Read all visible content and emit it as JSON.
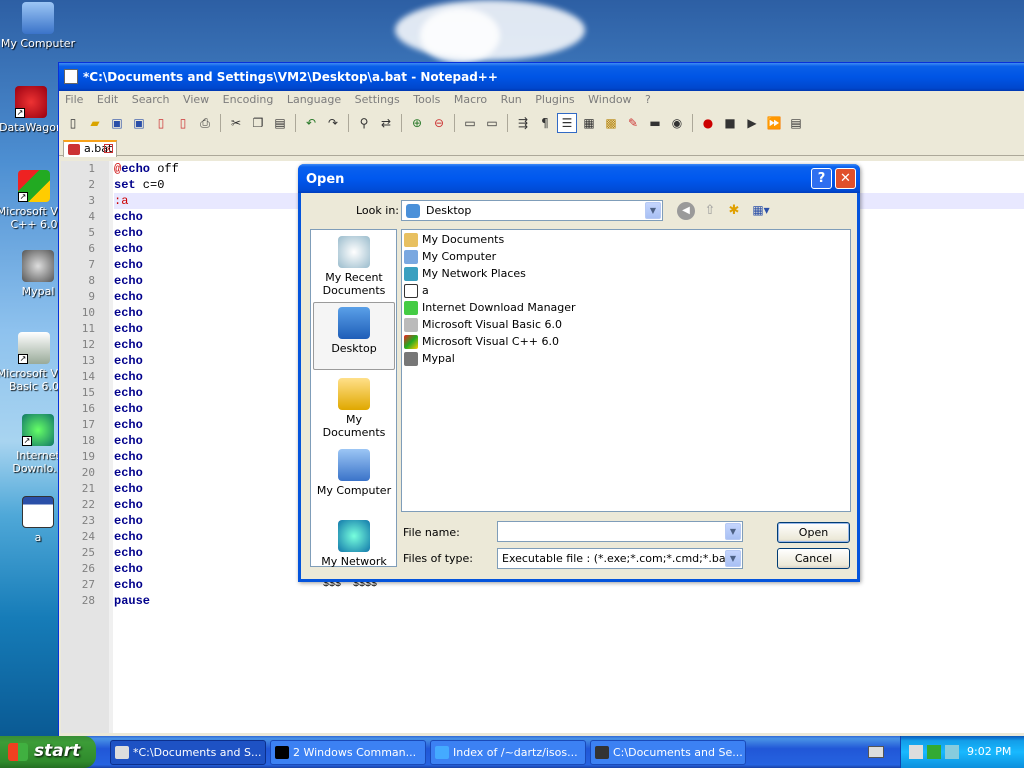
{
  "desktop": {
    "icons": [
      {
        "label": "My Computer"
      },
      {
        "label": "DataWagon"
      },
      {
        "label": "Microsoft Vi... C++ 6.0"
      },
      {
        "label": "Mypal"
      },
      {
        "label": "Microsoft Vi... Basic 6.0"
      },
      {
        "label": "Internet Downlo..."
      },
      {
        "label": "a"
      }
    ]
  },
  "notepad": {
    "title": "*C:\\Documents and Settings\\VM2\\Desktop\\a.bat - Notepad++",
    "menu": [
      "File",
      "Edit",
      "Search",
      "View",
      "Encoding",
      "Language",
      "Settings",
      "Tools",
      "Macro",
      "Run",
      "Plugins",
      "Window",
      "?"
    ],
    "tab": "a.bat",
    "lines": [
      {
        "n": "1",
        "parts": [
          {
            "t": "@",
            "c": "at"
          },
          {
            "t": "echo",
            "c": "kw"
          },
          {
            "t": " off",
            "c": ""
          }
        ]
      },
      {
        "n": "2",
        "parts": [
          {
            "t": "set",
            "c": "kw"
          },
          {
            "t": " c=0",
            "c": ""
          }
        ]
      },
      {
        "n": "3",
        "parts": [
          {
            "t": ":a",
            "c": "at"
          }
        ]
      },
      {
        "n": "4",
        "parts": [
          {
            "t": "echo",
            "c": "kw"
          }
        ]
      },
      {
        "n": "5",
        "parts": [
          {
            "t": "echo",
            "c": "kw"
          }
        ]
      },
      {
        "n": "6",
        "parts": [
          {
            "t": "echo",
            "c": "kw"
          }
        ]
      },
      {
        "n": "7",
        "parts": [
          {
            "t": "echo",
            "c": "kw"
          }
        ]
      },
      {
        "n": "8",
        "parts": [
          {
            "t": "echo",
            "c": "kw"
          }
        ]
      },
      {
        "n": "9",
        "parts": [
          {
            "t": "echo",
            "c": "kw"
          }
        ]
      },
      {
        "n": "10",
        "parts": [
          {
            "t": "echo",
            "c": "kw"
          }
        ]
      },
      {
        "n": "11",
        "parts": [
          {
            "t": "echo",
            "c": "kw"
          }
        ]
      },
      {
        "n": "12",
        "parts": [
          {
            "t": "echo",
            "c": "kw"
          }
        ]
      },
      {
        "n": "13",
        "parts": [
          {
            "t": "echo",
            "c": "kw"
          }
        ]
      },
      {
        "n": "14",
        "parts": [
          {
            "t": "echo",
            "c": "kw"
          }
        ]
      },
      {
        "n": "15",
        "parts": [
          {
            "t": "echo",
            "c": "kw"
          }
        ]
      },
      {
        "n": "16",
        "parts": [
          {
            "t": "echo",
            "c": "kw"
          }
        ]
      },
      {
        "n": "17",
        "parts": [
          {
            "t": "echo",
            "c": "kw"
          }
        ]
      },
      {
        "n": "18",
        "parts": [
          {
            "t": "echo",
            "c": "kw"
          }
        ]
      },
      {
        "n": "19",
        "parts": [
          {
            "t": "echo",
            "c": "kw"
          }
        ]
      },
      {
        "n": "20",
        "parts": [
          {
            "t": "echo",
            "c": "kw"
          }
        ]
      },
      {
        "n": "21",
        "parts": [
          {
            "t": "echo",
            "c": "kw"
          }
        ]
      },
      {
        "n": "22",
        "parts": [
          {
            "t": "echo",
            "c": "kw"
          }
        ]
      },
      {
        "n": "23",
        "parts": [
          {
            "t": "echo",
            "c": "kw"
          }
        ]
      },
      {
        "n": "24",
        "parts": [
          {
            "t": "echo",
            "c": "kw"
          }
        ]
      },
      {
        "n": "25",
        "parts": [
          {
            "t": "echo",
            "c": "kw"
          }
        ]
      },
      {
        "n": "26",
        "parts": [
          {
            "t": "echo",
            "c": "kw"
          }
        ]
      },
      {
        "n": "27",
        "parts": [
          {
            "t": "echo",
            "c": "kw"
          }
        ]
      },
      {
        "n": "28",
        "parts": [
          {
            "t": "pause",
            "c": "kw"
          }
        ]
      }
    ],
    "line27_tail": "$$$* $$$$*"
  },
  "dialog": {
    "title": "Open",
    "look_in_label": "Look in:",
    "look_in_value": "Desktop",
    "places": [
      "My Recent Documents",
      "Desktop",
      "My Documents",
      "My Computer",
      "My Network"
    ],
    "files": [
      "My Documents",
      "My Computer",
      "My Network Places",
      "a",
      "Internet Download Manager",
      "Microsoft Visual Basic 6.0",
      "Microsoft Visual C++ 6.0",
      "Mypal"
    ],
    "file_name_label": "File name:",
    "file_name_value": "",
    "file_type_label": "Files of type:",
    "file_type_value": "Executable file :  (*.exe;*.com;*.cmd;*.bat)",
    "open_label": "Open",
    "cancel_label": "Cancel"
  },
  "taskbar": {
    "start_label": "start",
    "tasks": [
      "*C:\\Documents and S...",
      "2 Windows Comman...",
      "Index of /~dartz/isos...",
      "C:\\Documents and Se..."
    ],
    "clock": "9:02 PM"
  }
}
